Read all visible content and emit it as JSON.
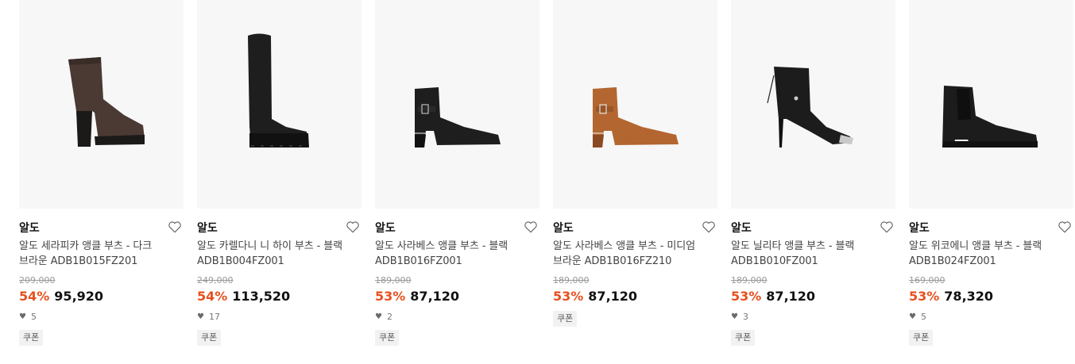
{
  "products": [
    {
      "brand": "알도",
      "name_line1": "알도 세라피카 앵클 부츠 - 다크",
      "name_line2": "브라운 ADB1B015FZ201",
      "original_price": "209,000",
      "discount": "54%",
      "price": "95,920",
      "likes": "5",
      "coupon": "쿠폰",
      "image_icon": "ankle-boot-brown-platform"
    },
    {
      "brand": "알도",
      "name_line1": "알도 카렐다니 니 하이 부츠 - 블랙",
      "name_line2": "ADB1B004FZ001",
      "original_price": "249,000",
      "discount": "54%",
      "price": "113,520",
      "likes": "17",
      "coupon": "쿠폰",
      "image_icon": "knee-high-boot-black"
    },
    {
      "brand": "알도",
      "name_line1": "알도 사라베스 앵클 부츠 - 블랙",
      "name_line2": "ADB1B016FZ001",
      "original_price": "189,000",
      "discount": "53%",
      "price": "87,120",
      "likes": "2",
      "coupon": "쿠폰",
      "image_icon": "ankle-boot-black-buckle"
    },
    {
      "brand": "알도",
      "name_line1": "알도 사라베스 앵클 부츠 - 미디엄",
      "name_line2": "브라운 ADB1B016FZ210",
      "original_price": "189,000",
      "discount": "53%",
      "price": "87,120",
      "likes": "",
      "coupon": "쿠폰",
      "image_icon": "ankle-boot-tan-buckle"
    },
    {
      "brand": "알도",
      "name_line1": "알도 닐리타 앵클 부츠 - 블랙",
      "name_line2": "ADB1B010FZ001",
      "original_price": "189,000",
      "discount": "53%",
      "price": "87,120",
      "likes": "3",
      "coupon": "쿠폰",
      "image_icon": "stiletto-ankle-boot-black"
    },
    {
      "brand": "알도",
      "name_line1": "알도 위코에니 앵클 부츠 - 블랙",
      "name_line2": "ADB1B024FZ001",
      "original_price": "169,000",
      "discount": "53%",
      "price": "78,320",
      "likes": "5",
      "coupon": "쿠폰",
      "image_icon": "chelsea-boot-black"
    }
  ],
  "colors": {
    "discount": "#e8501d",
    "image_bg": "#f7f7f7"
  }
}
